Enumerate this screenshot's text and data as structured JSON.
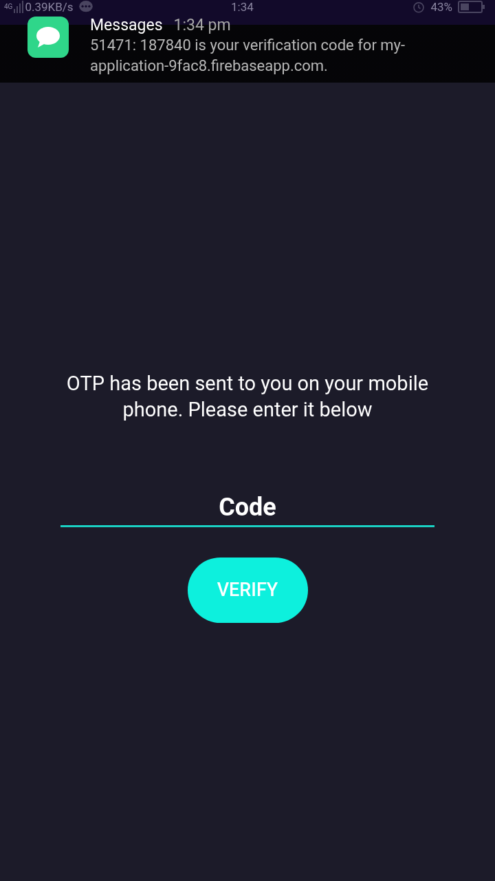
{
  "status_bar": {
    "network": "4G",
    "speed": "0.39KB/s",
    "time": "1:34",
    "battery_percent": "43%"
  },
  "notification": {
    "app": "Messages",
    "time": "1:34 pm",
    "message": "51471: 187840 is your verification code for my-application-9fac8.firebaseapp.com."
  },
  "instruction": "OTP has been sent to you on your mobile phone. Please enter it below",
  "code_field": {
    "placeholder": "Code"
  },
  "verify_button": {
    "label": "VERIFY"
  }
}
